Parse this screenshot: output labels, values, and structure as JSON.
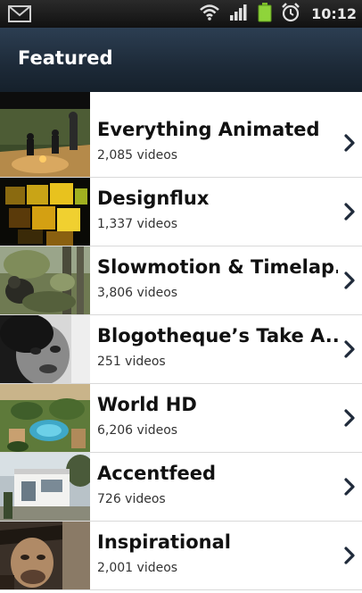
{
  "status_bar": {
    "time": "10:12",
    "icons": [
      "gmail-icon",
      "wifi-icon",
      "signal-icon",
      "battery-icon",
      "alarm-icon"
    ]
  },
  "action_bar": {
    "title": "Featured"
  },
  "channels": [
    {
      "name": "Everything Animated",
      "count": "2,085 videos",
      "thumb": "animated-scene"
    },
    {
      "name": "Designflux",
      "count": "1,337 videos",
      "thumb": "glowing-cubes"
    },
    {
      "name": "Slowmotion & Timelap...",
      "count": "3,806 videos",
      "thumb": "forest-animal"
    },
    {
      "name": "Blogotheque’s Take A...",
      "count": "251 videos",
      "thumb": "bw-face"
    },
    {
      "name": "World HD",
      "count": "6,206 videos",
      "thumb": "aerial-resort"
    },
    {
      "name": "Accentfeed",
      "count": "726 videos",
      "thumb": "modern-house"
    },
    {
      "name": "Inspirational",
      "count": "2,001 videos",
      "thumb": "portrait"
    }
  ],
  "colors": {
    "action_bar": "#1d2a38",
    "status_bar": "#111111",
    "divider": "#d9d9d9",
    "chevron": "#1f2a3a"
  }
}
